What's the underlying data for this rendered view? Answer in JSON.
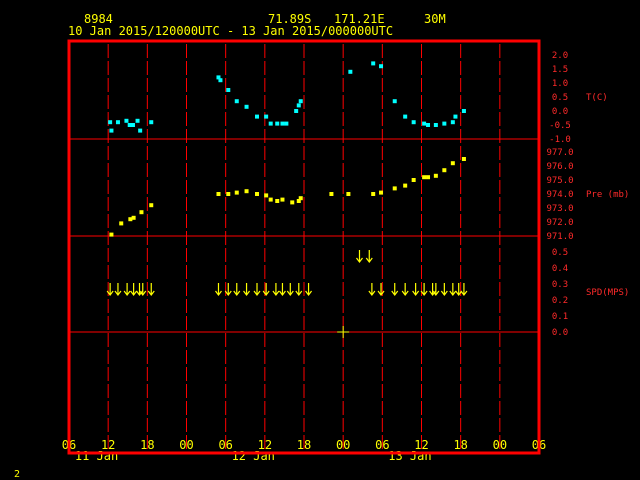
{
  "header": {
    "station_id": "8984",
    "latitude": "71.89S",
    "longitude": "171.21E",
    "height": "30M",
    "date_range": "10 Jan 2015/120000UTC - 13 Jan 2015/000000UTC"
  },
  "footer": {
    "page_number": "2"
  },
  "colors": {
    "frame": "#ff0000",
    "temperature": "#00ffff",
    "pressure": "#ffff00",
    "wind": "#ffff00",
    "axis_text": "#ff2a2a",
    "header_text": "#ffff00"
  },
  "chart_data": {
    "type": "scatter",
    "x_axis": {
      "unit": "hour",
      "range": [
        6,
        54
      ],
      "tick_labels": [
        "06",
        "12",
        "18",
        "00",
        "06",
        "12",
        "18",
        "00",
        "06",
        "12",
        "18",
        "00",
        "06"
      ],
      "day_labels": [
        {
          "label": "11 Jan",
          "at_hour": 24
        },
        {
          "label": "12 Jan",
          "at_hour": 48
        },
        {
          "label": "13 Jan",
          "at_hour": 72
        }
      ]
    },
    "panels": [
      {
        "id": "temperature",
        "label": "T(C)",
        "ylim": [
          -1.0,
          2.0
        ],
        "tick_labels": [
          "2.0",
          "1.5",
          "1.0",
          "0.5",
          "0.0",
          "-0.5",
          "-1.0"
        ],
        "points": [
          {
            "x": 12.3,
            "y": -0.4
          },
          {
            "x": 12.5,
            "y": -0.7
          },
          {
            "x": 13.5,
            "y": -0.4
          },
          {
            "x": 14.8,
            "y": -0.35
          },
          {
            "x": 15.3,
            "y": -0.5
          },
          {
            "x": 15.8,
            "y": -0.5
          },
          {
            "x": 16.5,
            "y": -0.35
          },
          {
            "x": 16.9,
            "y": -0.7
          },
          {
            "x": 18.6,
            "y": -0.4
          },
          {
            "x": 28.9,
            "y": 1.2
          },
          {
            "x": 29.2,
            "y": 1.1
          },
          {
            "x": 30.4,
            "y": 0.75
          },
          {
            "x": 31.7,
            "y": 0.35
          },
          {
            "x": 33.2,
            "y": 0.15
          },
          {
            "x": 34.8,
            "y": -0.2
          },
          {
            "x": 36.2,
            "y": -0.2
          },
          {
            "x": 36.9,
            "y": -0.45
          },
          {
            "x": 37.9,
            "y": -0.45
          },
          {
            "x": 38.7,
            "y": -0.45
          },
          {
            "x": 39.3,
            "y": -0.45
          },
          {
            "x": 40.8,
            "y": 0.0
          },
          {
            "x": 41.2,
            "y": 0.2
          },
          {
            "x": 41.5,
            "y": 0.35
          },
          {
            "x": 49.1,
            "y": 1.4
          },
          {
            "x": 52.6,
            "y": 1.7
          },
          {
            "x": 53.8,
            "y": 1.6
          },
          {
            "x": 55.9,
            "y": 0.35
          },
          {
            "x": 57.5,
            "y": -0.2
          },
          {
            "x": 58.8,
            "y": -0.4
          },
          {
            "x": 60.4,
            "y": -0.45
          },
          {
            "x": 61.0,
            "y": -0.5
          },
          {
            "x": 62.2,
            "y": -0.5
          },
          {
            "x": 63.5,
            "y": -0.45
          },
          {
            "x": 64.8,
            "y": -0.4
          },
          {
            "x": 65.2,
            "y": -0.2
          },
          {
            "x": 66.5,
            "y": 0.0
          }
        ]
      },
      {
        "id": "pressure",
        "label": "Pre (mb)",
        "ylim": [
          971.0,
          977.0
        ],
        "tick_labels": [
          "977.0",
          "976.0",
          "975.0",
          "974.0",
          "973.0",
          "972.0",
          "971.0"
        ],
        "points": [
          {
            "x": 12.5,
            "y": 971.1
          },
          {
            "x": 14.0,
            "y": 971.9
          },
          {
            "x": 15.4,
            "y": 972.2
          },
          {
            "x": 15.9,
            "y": 972.3
          },
          {
            "x": 17.1,
            "y": 972.7
          },
          {
            "x": 18.6,
            "y": 973.2
          },
          {
            "x": 28.9,
            "y": 974.0
          },
          {
            "x": 30.4,
            "y": 974.0
          },
          {
            "x": 31.7,
            "y": 974.1
          },
          {
            "x": 33.2,
            "y": 974.2
          },
          {
            "x": 34.8,
            "y": 974.0
          },
          {
            "x": 36.2,
            "y": 973.9
          },
          {
            "x": 36.9,
            "y": 973.6
          },
          {
            "x": 37.9,
            "y": 973.5
          },
          {
            "x": 38.7,
            "y": 973.6
          },
          {
            "x": 40.2,
            "y": 973.4
          },
          {
            "x": 41.2,
            "y": 973.5
          },
          {
            "x": 41.5,
            "y": 973.7
          },
          {
            "x": 46.2,
            "y": 974.0
          },
          {
            "x": 48.8,
            "y": 974.0
          },
          {
            "x": 52.6,
            "y": 974.0
          },
          {
            "x": 53.8,
            "y": 974.1
          },
          {
            "x": 55.9,
            "y": 974.4
          },
          {
            "x": 57.5,
            "y": 974.6
          },
          {
            "x": 58.8,
            "y": 975.0
          },
          {
            "x": 60.4,
            "y": 975.2
          },
          {
            "x": 61.0,
            "y": 975.2
          },
          {
            "x": 62.2,
            "y": 975.3
          },
          {
            "x": 63.5,
            "y": 975.7
          },
          {
            "x": 64.8,
            "y": 976.2
          },
          {
            "x": 66.5,
            "y": 976.5
          }
        ]
      },
      {
        "id": "wind",
        "label": "SPD(MPS)",
        "ylim": [
          0.0,
          0.5
        ],
        "tick_labels": [
          "0.5",
          "0.4",
          "0.3",
          "0.2",
          "0.1",
          "0.0"
        ],
        "arrow_x_hours": [
          12.3,
          13.5,
          14.9,
          15.9,
          16.8,
          17.3,
          18.6,
          28.9,
          30.4,
          31.7,
          33.2,
          34.8,
          36.2,
          37.7,
          38.7,
          39.9,
          41.2,
          42.7,
          52.4,
          53.8,
          55.9,
          57.5,
          59.1,
          60.4,
          61.7,
          62.2,
          63.5,
          64.8,
          65.7,
          66.5
        ]
      }
    ],
    "center_marker": {
      "x": 48,
      "y": 0.0
    }
  }
}
